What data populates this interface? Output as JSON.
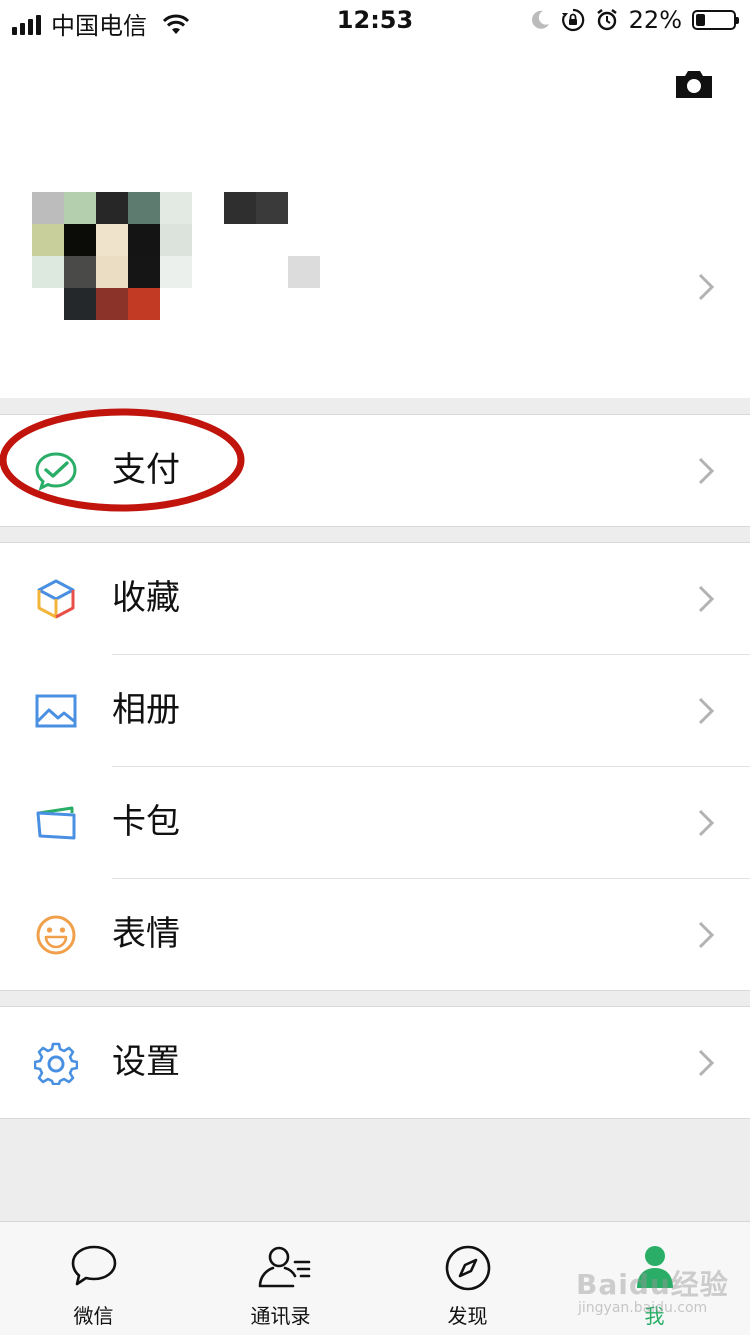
{
  "status_bar": {
    "carrier": "中国电信",
    "time": "12:53",
    "battery": "22%"
  },
  "menu": {
    "pay": {
      "label": "支付",
      "icon": "wechat-pay-icon",
      "color": "#2aae67"
    },
    "items": [
      {
        "label": "收藏",
        "icon": "favorites-cube-icon"
      },
      {
        "label": "相册",
        "icon": "album-picture-icon",
        "color": "#4a90e2"
      },
      {
        "label": "卡包",
        "icon": "card-wallet-icon",
        "color": "#4a90e2"
      },
      {
        "label": "表情",
        "icon": "sticker-smile-icon",
        "color": "#f0a04b"
      }
    ],
    "settings": {
      "label": "设置",
      "icon": "gear-icon",
      "color": "#4a90e2"
    }
  },
  "tab_bar": {
    "tabs": [
      {
        "label": "微信",
        "icon": "chat-bubble-icon"
      },
      {
        "label": "通讯录",
        "icon": "contacts-icon"
      },
      {
        "label": "发现",
        "icon": "compass-icon"
      },
      {
        "label": "我",
        "icon": "me-person-icon",
        "active": true
      }
    ],
    "active_color": "#2aae67"
  },
  "watermark": {
    "brand": "Baidu经验",
    "url": "jingyan.baidu.com"
  }
}
